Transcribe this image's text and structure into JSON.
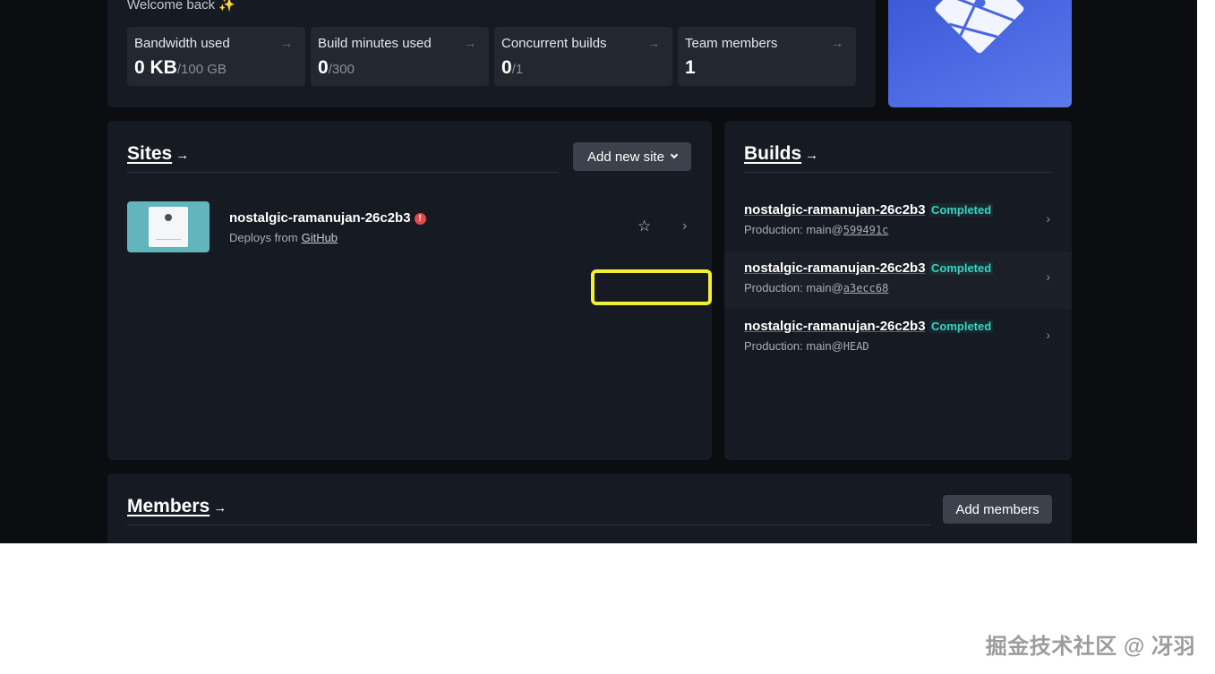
{
  "header": {
    "welcome": "Welcome back ✨"
  },
  "stats": [
    {
      "label": "Bandwidth used",
      "value": "0 KB",
      "limit": "/100 GB"
    },
    {
      "label": "Build minutes used",
      "value": "0",
      "limit": "/300"
    },
    {
      "label": "Concurrent builds",
      "value": "0",
      "limit": "/1"
    },
    {
      "label": "Team members",
      "value": "1",
      "limit": ""
    }
  ],
  "sites": {
    "title": "Sites",
    "title_arrow": "→",
    "add_button": "Add new site",
    "items": [
      {
        "name": "nostalgic-ramanujan-26c2b3",
        "deploys_prefix": "Deploys from",
        "source": "GitHub",
        "status_icon": "warning-icon"
      }
    ]
  },
  "builds": {
    "title": "Builds",
    "title_arrow": "→",
    "items": [
      {
        "name": "nostalgic-ramanujan-26c2b3",
        "status": "Completed",
        "context": "Production: main@",
        "commit": "599491c"
      },
      {
        "name": "nostalgic-ramanujan-26c2b3",
        "status": "Completed",
        "context": "Production: main@",
        "commit": "a3ecc68"
      },
      {
        "name": "nostalgic-ramanujan-26c2b3",
        "status": "Completed",
        "context": "Production: main@",
        "commit": "HEAD"
      }
    ]
  },
  "members": {
    "title": "Members",
    "title_arrow": "→",
    "add_button": "Add members"
  },
  "icons": {
    "arrow": "→",
    "chevron_right": "›",
    "star": "☆",
    "warning": "!"
  },
  "colors": {
    "background": "#0b0d11",
    "panel": "#161a22",
    "accent_status": "#39d3c2",
    "highlight": "#f2ef33",
    "logo_card": "#4e6ce4"
  },
  "watermark": "掘金技术社区 @ 冴羽"
}
